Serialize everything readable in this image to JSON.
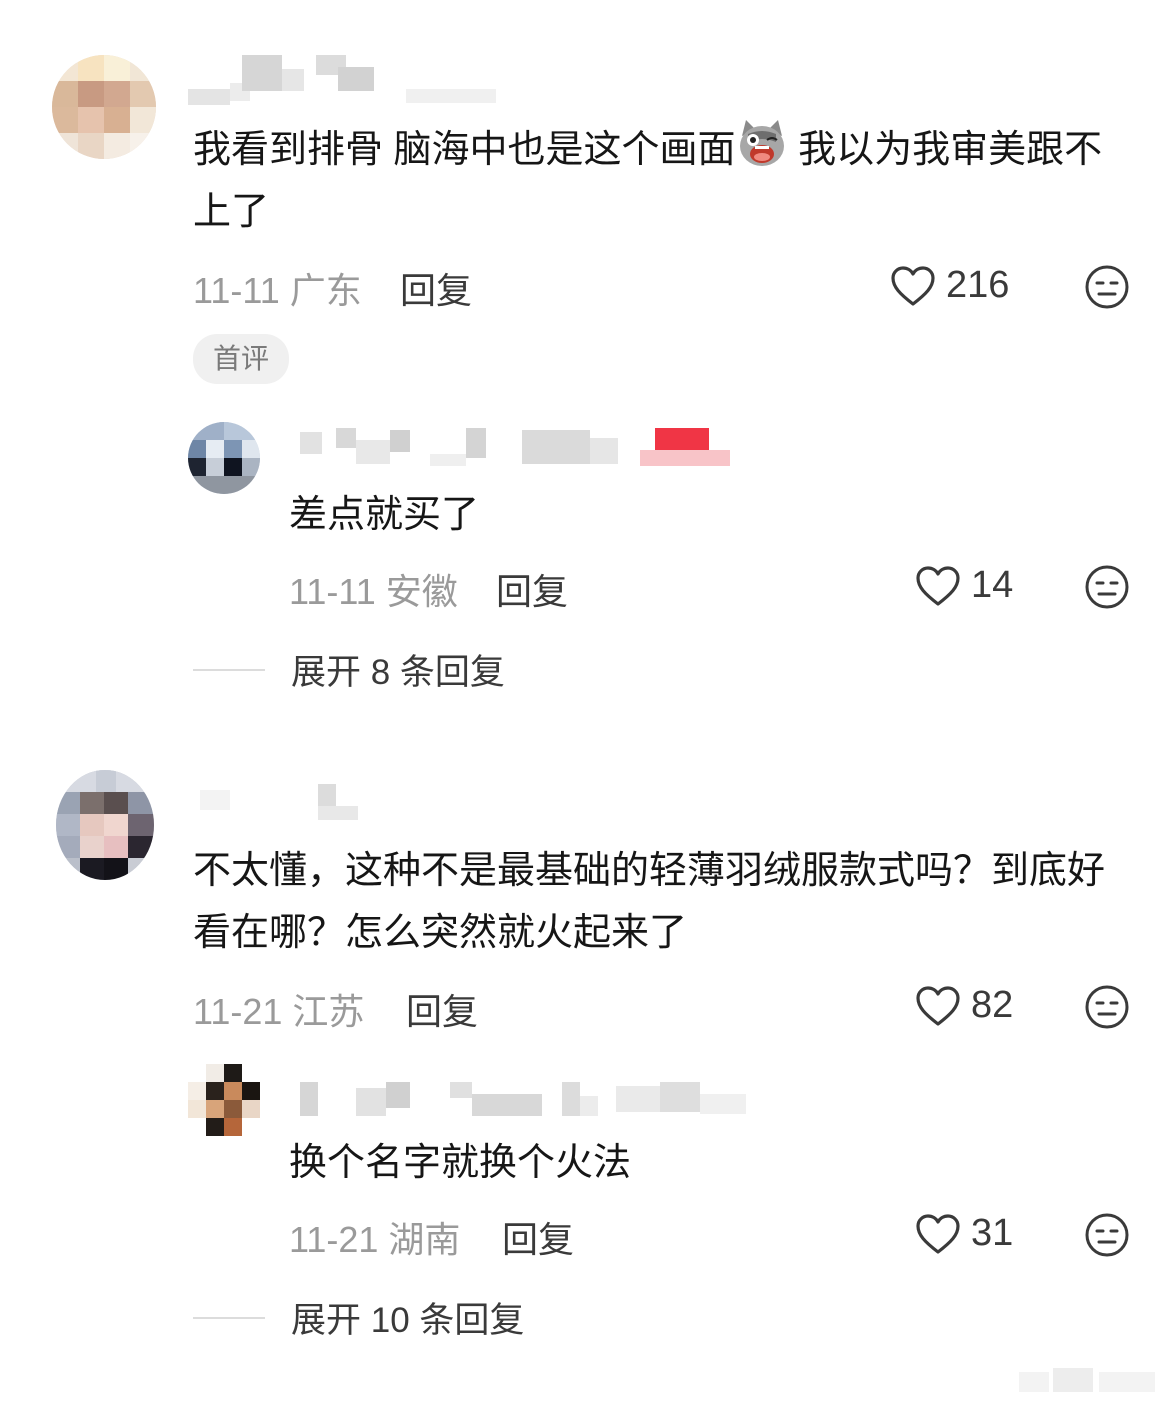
{
  "comments": [
    {
      "text_before_emoji": "我看到排骨 脑海中也是这个画面",
      "emoji": "cat-crying-emoji",
      "text_after_emoji": " 我以为我审美跟不上了",
      "date": "11-11",
      "region": "广东",
      "reply_label": "回复",
      "likes": "216",
      "badge": "首评",
      "replies": [
        {
          "text": "差点就买了",
          "date": "11-11",
          "region": "安徽",
          "reply_label": "回复",
          "likes": "14"
        }
      ],
      "expand_label": "展开 8 条回复"
    },
    {
      "text": "不太懂，这种不是最基础的轻薄羽绒服款式吗？到底好看在哪？怎么突然就火起来了",
      "date": "11-21",
      "region": "江苏",
      "reply_label": "回复",
      "likes": "82",
      "replies": [
        {
          "text": "换个名字就换个火法",
          "date": "11-21",
          "region": "湖南",
          "reply_label": "回复",
          "likes": "31"
        }
      ],
      "expand_label": "展开 10 条回复"
    }
  ],
  "colors": {
    "text": "#161616",
    "meta": "#9a9a9a",
    "icon": "#3a3a3a",
    "badge_bg": "#f0f0f0"
  }
}
